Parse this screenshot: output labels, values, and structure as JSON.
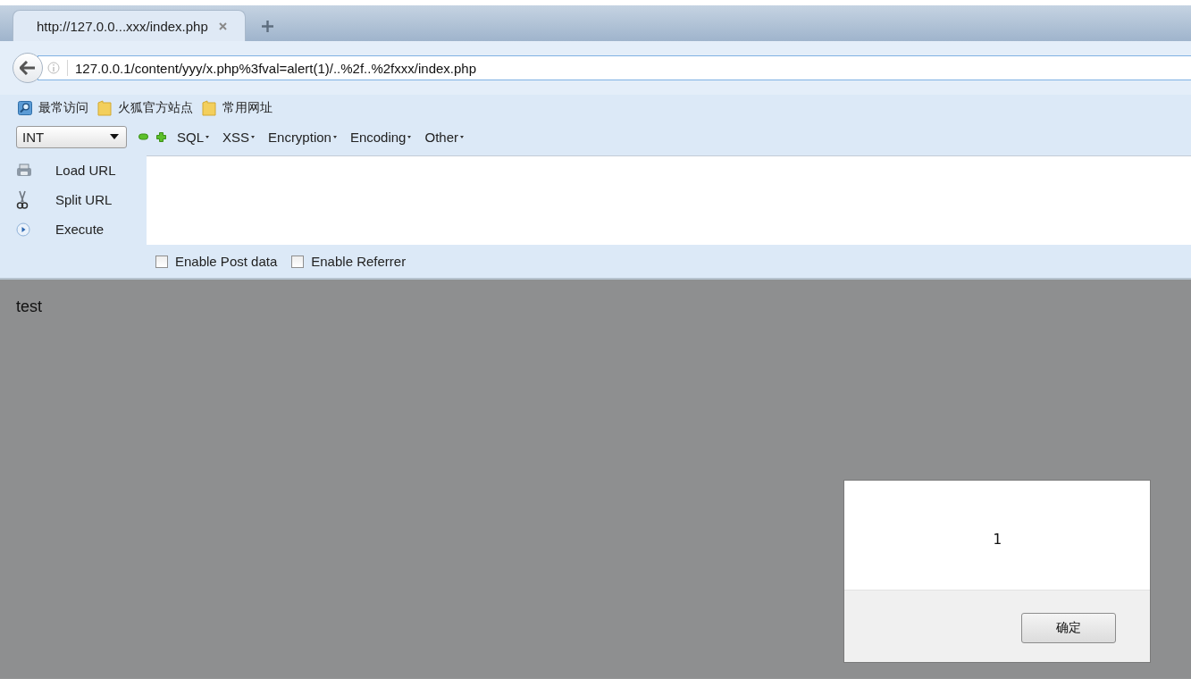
{
  "tabs": [
    {
      "title": "http://127.0.0...xxx/index.php",
      "selected": true
    }
  ],
  "address_bar": {
    "value": "127.0.0.1/content/yyy/x.php%3fval=alert(1)/..%2f..%2fxxx/index.php"
  },
  "bookmarks": [
    {
      "kind": "search",
      "label": "最常访问"
    },
    {
      "kind": "folder",
      "label": "火狐官方站点"
    },
    {
      "kind": "folder",
      "label": "常用网址"
    }
  ],
  "hackbar": {
    "select": "INT",
    "menus": [
      "SQL",
      "XSS",
      "Encryption",
      "Encoding",
      "Other"
    ],
    "actions": [
      {
        "kind": "load",
        "label": "Load URL"
      },
      {
        "kind": "split",
        "label": "Split URL"
      },
      {
        "kind": "execute",
        "label": "Execute"
      }
    ],
    "options": [
      {
        "label": "Enable Post data",
        "checked": false
      },
      {
        "label": "Enable Referrer",
        "checked": false
      }
    ]
  },
  "page": {
    "text": "test"
  },
  "alert": {
    "message": "1",
    "button": "确定"
  }
}
